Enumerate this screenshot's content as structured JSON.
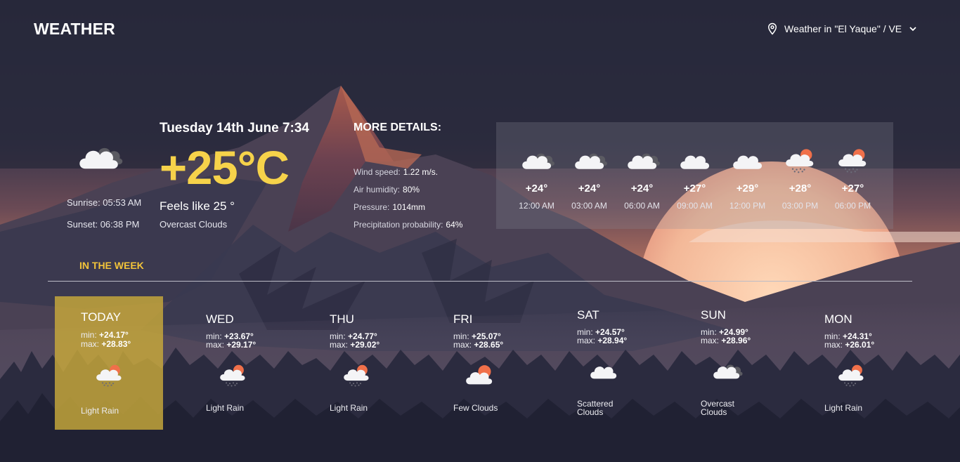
{
  "app": {
    "title": "WEATHER"
  },
  "location": {
    "label": "Weather in \"El Yaque\" / VE",
    "icon": "location-pin-icon"
  },
  "current": {
    "icon": "overcast-clouds-icon",
    "sunrise": "Sunrise: 05:53 AM",
    "sunset": "Sunset: 06:38 PM",
    "datetime": "Tuesday 14th June 7:34",
    "temperature": "+25°C",
    "feels_like": "Feels like 25 °",
    "condition": "Overcast Clouds"
  },
  "details": {
    "title": "MORE DETAILS:",
    "rows": [
      {
        "label": "Wind speed:",
        "value": "1.22 m/s."
      },
      {
        "label": "Air humidity:",
        "value": "80%"
      },
      {
        "label": "Pressure:",
        "value": "1014mm"
      },
      {
        "label": "Precipitation probability:",
        "value": "64%"
      }
    ]
  },
  "hourly": [
    {
      "icon": "overcast-clouds-icon",
      "temp": "+24°",
      "time": "12:00 AM"
    },
    {
      "icon": "overcast-clouds-icon",
      "temp": "+24°",
      "time": "03:00 AM"
    },
    {
      "icon": "overcast-clouds-icon",
      "temp": "+24°",
      "time": "06:00 AM"
    },
    {
      "icon": "cloud-icon",
      "temp": "+27°",
      "time": "09:00 AM"
    },
    {
      "icon": "cloud-icon",
      "temp": "+29°",
      "time": "12:00 PM"
    },
    {
      "icon": "light-rain-icon",
      "temp": "+28°",
      "time": "03:00 PM"
    },
    {
      "icon": "light-rain-icon",
      "temp": "+27°",
      "time": "06:00 PM"
    }
  ],
  "week": {
    "title": "IN THE WEEK",
    "days": [
      {
        "day": "TODAY",
        "min_label": "min:",
        "min": "+24.17°",
        "max_label": "max:",
        "max": "+28.83°",
        "icon": "light-rain-icon",
        "condition": "Light Rain",
        "selected": true
      },
      {
        "day": "WED",
        "min_label": "min:",
        "min": "+23.67°",
        "max_label": "max:",
        "max": "+29.17°",
        "icon": "light-rain-icon",
        "condition": "Light Rain"
      },
      {
        "day": "THU",
        "min_label": "min:",
        "min": "+24.77°",
        "max_label": "max:",
        "max": "+29.02°",
        "icon": "light-rain-icon",
        "condition": "Light Rain"
      },
      {
        "day": "FRI",
        "min_label": "min:",
        "min": "+25.07°",
        "max_label": "max:",
        "max": "+28.65°",
        "icon": "few-clouds-icon",
        "condition": "Few Clouds"
      },
      {
        "day": "SAT",
        "min_label": "min:",
        "min": "+24.57°",
        "max_label": "max:",
        "max": "+28.94°",
        "icon": "scattered-clouds-icon",
        "condition_lines": [
          "Scattered",
          "Clouds"
        ]
      },
      {
        "day": "SUN",
        "min_label": "min:",
        "min": "+24.99°",
        "max_label": "max:",
        "max": "+28.96°",
        "icon": "overcast-clouds-icon",
        "condition_lines": [
          "Overcast",
          "Clouds"
        ]
      },
      {
        "day": "MON",
        "min_label": "min:",
        "min": "+24.31°",
        "max_label": "max:",
        "max": "+26.01°",
        "icon": "light-rain-icon",
        "condition": "Light Rain"
      }
    ]
  },
  "colors": {
    "accent_yellow": "#f6d24a",
    "week_title": "#f2c43a",
    "today_highlight": "#c9aa3a",
    "sun_orange": "#f0704a"
  }
}
